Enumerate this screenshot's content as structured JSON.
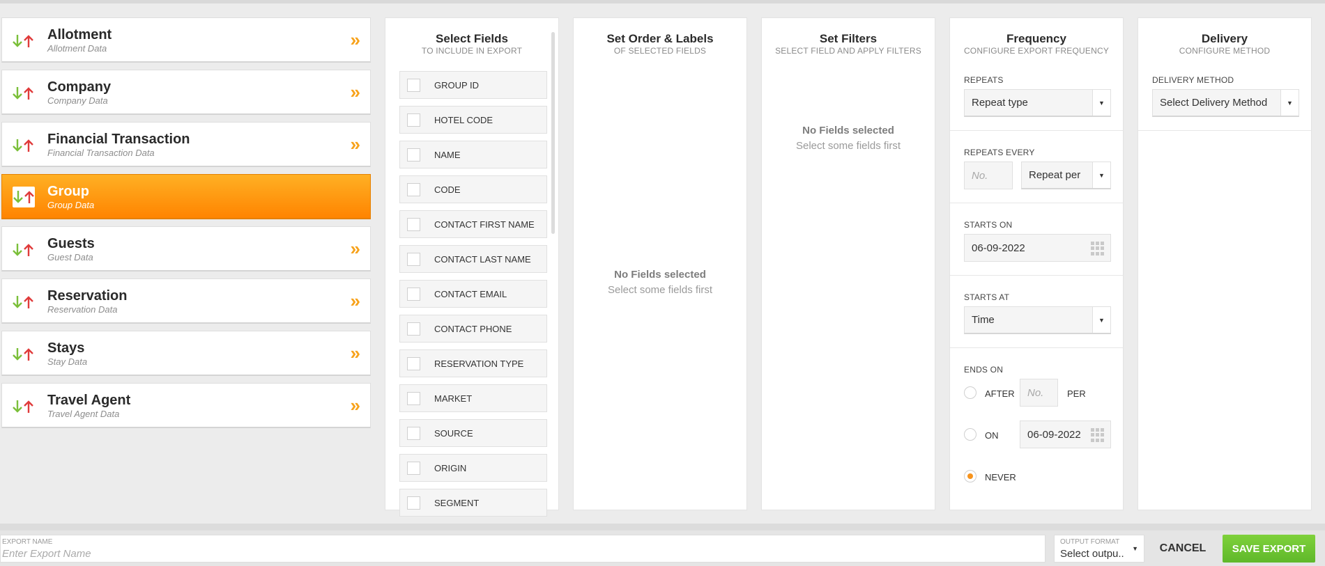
{
  "sources": [
    {
      "title": "Allotment",
      "subtitle": "Allotment Data",
      "active": false
    },
    {
      "title": "Company",
      "subtitle": "Company Data",
      "active": false
    },
    {
      "title": "Financial Transaction",
      "subtitle": "Financial Transaction Data",
      "active": false
    },
    {
      "title": "Group",
      "subtitle": "Group Data",
      "active": true
    },
    {
      "title": "Guests",
      "subtitle": "Guest Data",
      "active": false
    },
    {
      "title": "Reservation",
      "subtitle": "Reservation Data",
      "active": false
    },
    {
      "title": "Stays",
      "subtitle": "Stay Data",
      "active": false
    },
    {
      "title": "Travel Agent",
      "subtitle": "Travel Agent Data",
      "active": false
    }
  ],
  "icons": {
    "expand": "double-chevron-right-icon",
    "sort": "sort-arrows-icon",
    "calendar": "calendar-grid-icon"
  },
  "colors": {
    "accent": "#f7941d",
    "active_start": "#ffb024",
    "active_end": "#ff8400",
    "save": "#6cc431",
    "arrow_down": "#7bbf3a",
    "arrow_up": "#e03b3b"
  },
  "select_fields": {
    "title": "Select Fields",
    "subtitle": "TO INCLUDE IN EXPORT",
    "fields": [
      "GROUP ID",
      "HOTEL CODE",
      "NAME",
      "CODE",
      "CONTACT FIRST NAME",
      "CONTACT LAST NAME",
      "CONTACT EMAIL",
      "CONTACT PHONE",
      "RESERVATION TYPE",
      "MARKET",
      "SOURCE",
      "ORIGIN",
      "SEGMENT"
    ]
  },
  "order_labels": {
    "title": "Set Order & Labels",
    "subtitle": "OF SELECTED FIELDS",
    "empty_title": "No Fields selected",
    "empty_text": "Select some fields first"
  },
  "filters": {
    "title": "Set Filters",
    "subtitle": "SELECT FIELD AND APPLY FILTERS",
    "empty_title": "No Fields selected",
    "empty_text": "Select some fields first"
  },
  "frequency": {
    "title": "Frequency",
    "subtitle": "CONFIGURE EXPORT FREQUENCY",
    "repeats_label": "REPEATS",
    "repeats_value": "Repeat type",
    "repeats_every_label": "REPEATS EVERY",
    "repeats_every_placeholder": "No.",
    "repeats_per_value": "Repeat per",
    "starts_on_label": "STARTS ON",
    "starts_on_value": "06-09-2022",
    "starts_at_label": "STARTS AT",
    "starts_at_value": "Time",
    "ends_on_label": "ENDS ON",
    "after_label": "AFTER",
    "after_placeholder": "No.",
    "per_label": "PER",
    "on_label": "ON",
    "on_value": "06-09-2022",
    "never_label": "NEVER",
    "selected_end": "never"
  },
  "delivery": {
    "title": "Delivery",
    "subtitle": "CONFIGURE METHOD",
    "method_label": "DELIVERY METHOD",
    "method_value": "Select Delivery Method"
  },
  "footer": {
    "export_name_label": "EXPORT NAME",
    "export_name_placeholder": "Enter Export Name",
    "output_format_label": "OUTPUT FORMAT",
    "output_format_value": "Select outpu..",
    "cancel_label": "CANCEL",
    "save_label": "SAVE EXPORT"
  }
}
